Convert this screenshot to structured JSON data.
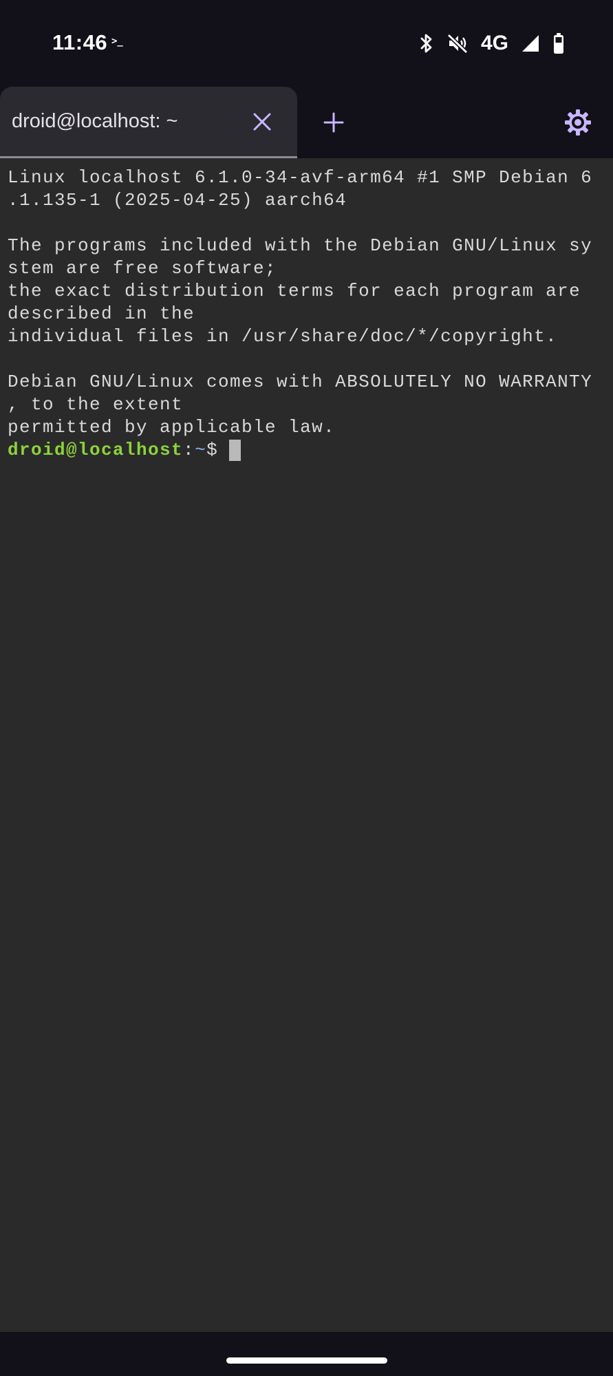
{
  "status_bar": {
    "time": "11:46",
    "terminal_indicator": ">_",
    "network": "4G",
    "icons": [
      "bluetooth-icon",
      "mute-icon",
      "signal-icon",
      "battery-icon"
    ]
  },
  "tab_bar": {
    "tab_title": "droid@localhost: ~",
    "close_icon": "close-icon",
    "new_tab_icon": "plus-icon",
    "settings_icon": "gear-icon",
    "accent_color": "#c7b7ff"
  },
  "terminal": {
    "lines": [
      "Linux localhost 6.1.0-34-avf-arm64 #1 SMP Debian 6",
      ".1.135-1 (2025-04-25) aarch64",
      "",
      "The programs included with the Debian GNU/Linux sy",
      "stem are free software;",
      "the exact distribution terms for each program are",
      "described in the",
      "individual files in /usr/share/doc/*/copyright.",
      "",
      "Debian GNU/Linux comes with ABSOLUTELY NO WARRANTY",
      ", to the extent",
      "permitted by applicable law."
    ],
    "prompt": {
      "user_host": "droid@localhost",
      "separator": ":",
      "path": "~",
      "symbol": "$"
    },
    "colors": {
      "background": "#2a2a2a",
      "text": "#d9d9d9",
      "prompt_user": "#8dd23c",
      "prompt_path": "#8ab4f8"
    }
  }
}
